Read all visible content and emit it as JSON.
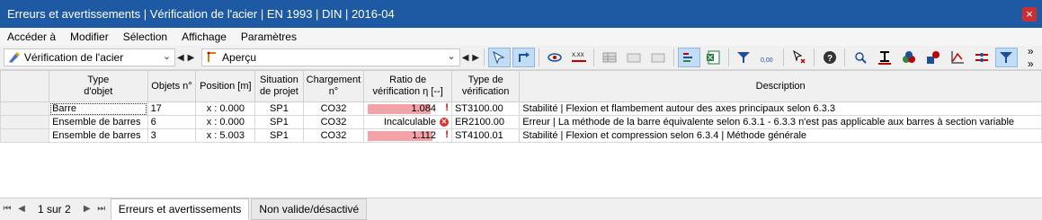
{
  "window": {
    "title": "Erreurs et avertissements | Vérification de l'acier | EN 1993 | DIN | 2016-04",
    "close": "×"
  },
  "menu": [
    "Accéder à",
    "Modifier",
    "Sélection",
    "Affichage",
    "Paramètres"
  ],
  "toolbar": {
    "combo1": "Vérification de l'acier",
    "combo2": "Aperçu",
    "xxx_icon_text": "X.XX",
    "zero_icon_text": "0,00",
    "overflow": "» »"
  },
  "table": {
    "headers": [
      "",
      "Type\nd'objet",
      "Objets n°",
      "Position [m]",
      "Situation\nde projet",
      "Chargement\nn°",
      "Ratio de\nvérification η [--]",
      "Type de\nvérification",
      "Description"
    ],
    "rows": [
      {
        "type": "Barre",
        "objets": "17",
        "position": "x : 0.000",
        "situation": "SP1",
        "chargement": "CO32",
        "ratio": "1.084",
        "ratio_value": 1.084,
        "marker": "warn",
        "verif": "ST3100.00",
        "description": "Stabilité | Flexion et flambement autour des axes principaux selon 6.3.3"
      },
      {
        "type": "Ensemble de barres",
        "objets": "6",
        "position": "x : 0.000",
        "situation": "SP1",
        "chargement": "CO32",
        "ratio": "Incalculable",
        "ratio_value": null,
        "marker": "err",
        "verif": "ER2100.00",
        "description": "Erreur | La méthode de la barre équivalente selon 6.3.1 - 6.3.3 n'est pas applicable aux barres à section variable"
      },
      {
        "type": "Ensemble de barres",
        "objets": "3",
        "position": "x : 5.003",
        "situation": "SP1",
        "chargement": "CO32",
        "ratio": "1.112",
        "ratio_value": 1.112,
        "marker": "warn",
        "verif": "ST4100.01",
        "description": "Stabilité | Flexion et compression selon 6.3.4 | Méthode générale"
      }
    ]
  },
  "status": {
    "page": "1 sur 2",
    "tabs": [
      "Erreurs et avertissements",
      "Non valide/désactivé"
    ]
  },
  "colors": {
    "titlebar": "#1e5aa3",
    "close": "#c92f34",
    "ratio_bar": "#f3a3a8",
    "warning": "#c00000",
    "error": "#d9302c"
  }
}
